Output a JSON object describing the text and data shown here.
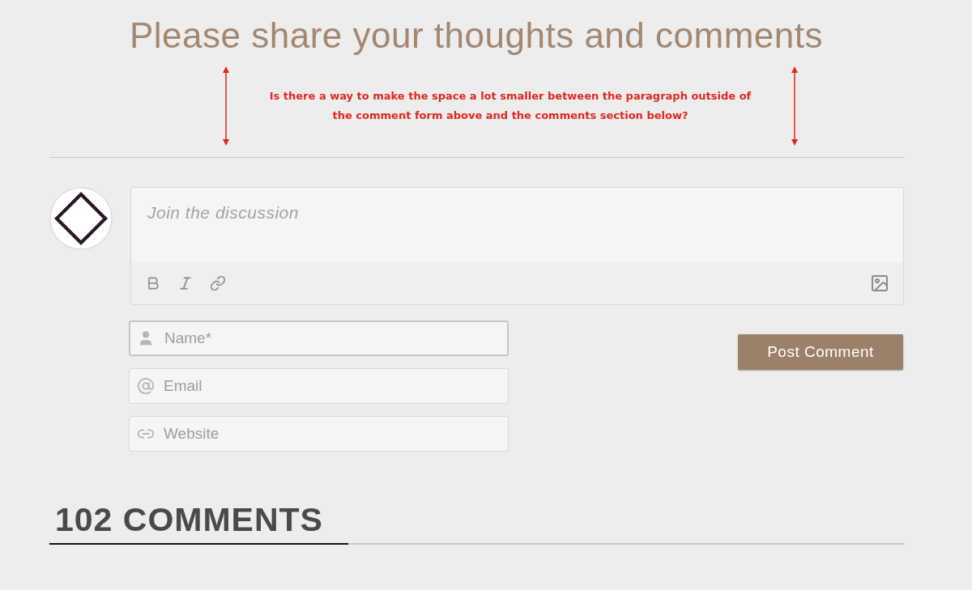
{
  "title": "Please share your thoughts and comments",
  "annotation": {
    "text": "Is there a way to make the space a lot smaller between the paragraph outside of the comment form above and the comments section below?"
  },
  "editor": {
    "placeholder": "Join the discussion"
  },
  "fields": [
    {
      "kind": "name",
      "placeholder": "Name*",
      "focused": true
    },
    {
      "kind": "email",
      "placeholder": "Email",
      "focused": false
    },
    {
      "kind": "website",
      "placeholder": "Website",
      "focused": false
    }
  ],
  "submit": "Post Comment",
  "comments_heading": "102 COMMENTS"
}
